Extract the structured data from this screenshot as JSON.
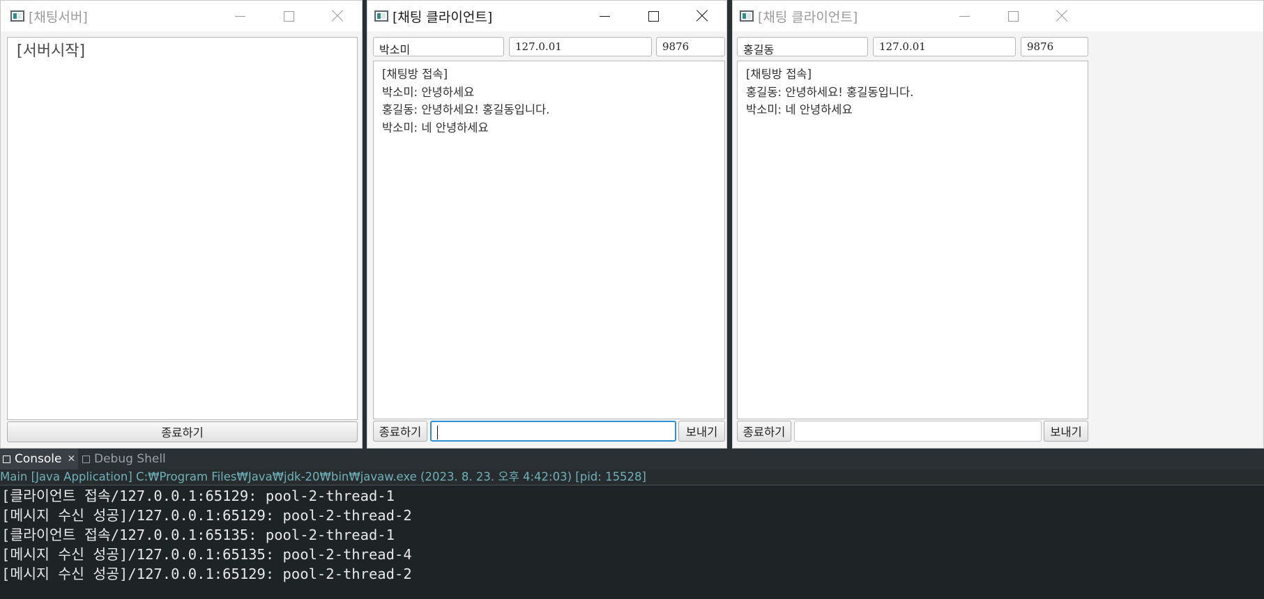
{
  "server_window": {
    "title": "[채팅서버]",
    "log_lines": [
      "[서버시작]"
    ],
    "stop_button": "종료하기"
  },
  "client1": {
    "title": "[채팅 클라이언트]",
    "active": true,
    "name": "박소미",
    "ip": "127.0.01",
    "port": "9876",
    "chat_lines": [
      "[채팅방 접속]",
      "박소미: 안녕하세요",
      "홍길동: 안녕하세요! 홍길동입니다.",
      "박소미: 네 안녕하세요"
    ],
    "stop_button": "종료하기",
    "message_value": "",
    "send_button": "보내기"
  },
  "client2": {
    "title": "[채팅 클라이언트]",
    "active": false,
    "name": "홍길동",
    "ip": "127.0.01",
    "port": "9876",
    "chat_lines": [
      "[채팅방 접속]",
      "홍길동: 안녕하세요! 홍길동입니다.",
      "박소미: 네 안녕하세요"
    ],
    "stop_button": "종료하기",
    "message_value": "",
    "send_button": "보내기"
  },
  "console": {
    "tabs": [
      {
        "label": "Console",
        "active": true,
        "closable": true,
        "icon": "console-icon"
      },
      {
        "label": "Debug Shell",
        "active": false,
        "closable": false,
        "icon": "debug-shell-icon"
      }
    ],
    "run_info": "Main [Java Application] C:₩Program Files₩Java₩jdk-20₩bin₩javaw.exe  (2023. 8. 23. 오후 4:42:03) [pid: 15528]",
    "lines": [
      "[클라이언트 접속/127.0.0.1:65129: pool-2-thread-1",
      "[메시지 수신 성공]/127.0.0.1:65129: pool-2-thread-2",
      "[클라이언트 접속/127.0.0.1:65135: pool-2-thread-1",
      "[메시지 수신 성공]/127.0.0.1:65135: pool-2-thread-4",
      "[메시지 수신 성공]/127.0.0.1:65129: pool-2-thread-2"
    ]
  },
  "colors": {
    "accent_focus": "#2f8fd0",
    "console_bg": "#1e2326",
    "run_info_text": "#6fb0b8"
  }
}
